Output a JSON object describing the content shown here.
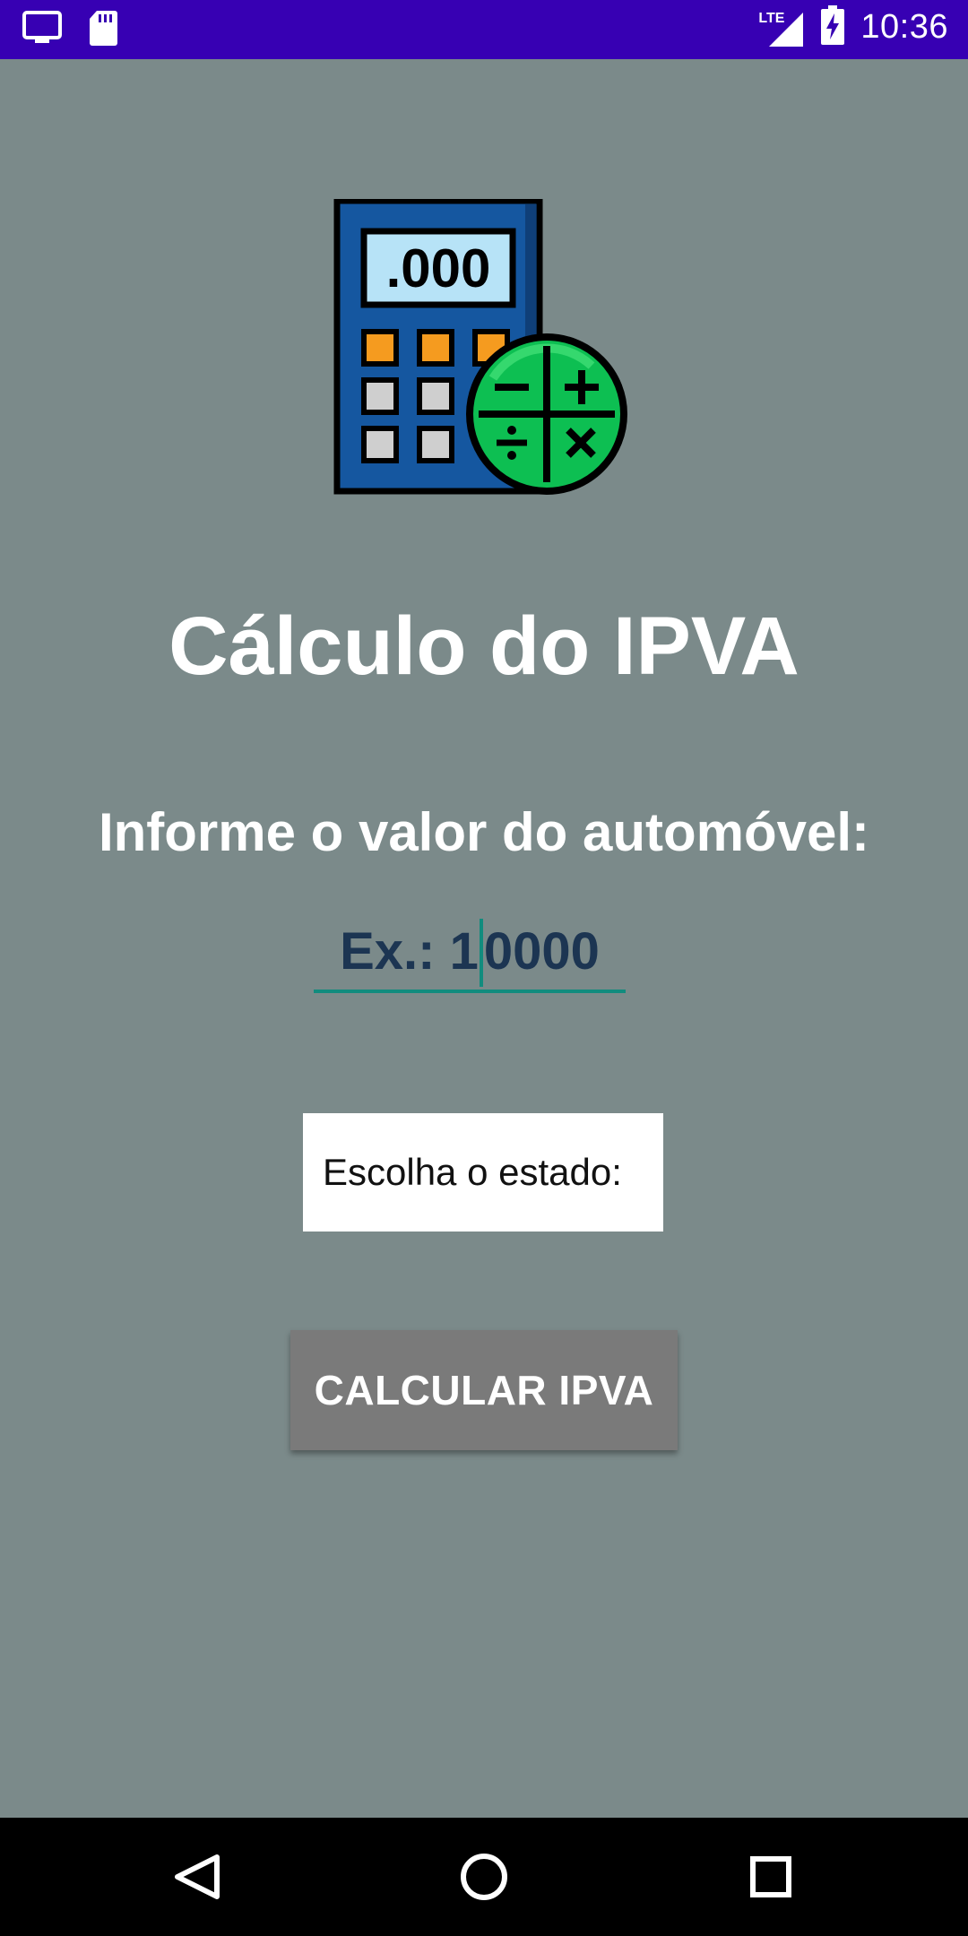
{
  "status_bar": {
    "time": "10:36",
    "network": "LTE",
    "icons": [
      "cast-screen-icon",
      "sd-card-icon",
      "lte-signal-icon",
      "battery-charging-icon"
    ]
  },
  "app": {
    "logo": "calculator-icon",
    "title": "Cálculo do IPVA",
    "prompt": "Informe o valor do automóvel:",
    "value_input": {
      "text_before_cursor": "Ex.: 1",
      "text_after_cursor": "0000"
    },
    "state_select": {
      "label": "Escolha o estado:"
    },
    "calculate_button": "CALCULAR IPVA"
  },
  "nav_bar": {
    "icons": [
      "back-icon",
      "home-icon",
      "recents-icon"
    ]
  },
  "colors": {
    "status_bar": "#3700b3",
    "background": "#7b8a8a",
    "accent": "#128c7e",
    "input_text": "#1c3552",
    "button": "#7a7a7a"
  }
}
